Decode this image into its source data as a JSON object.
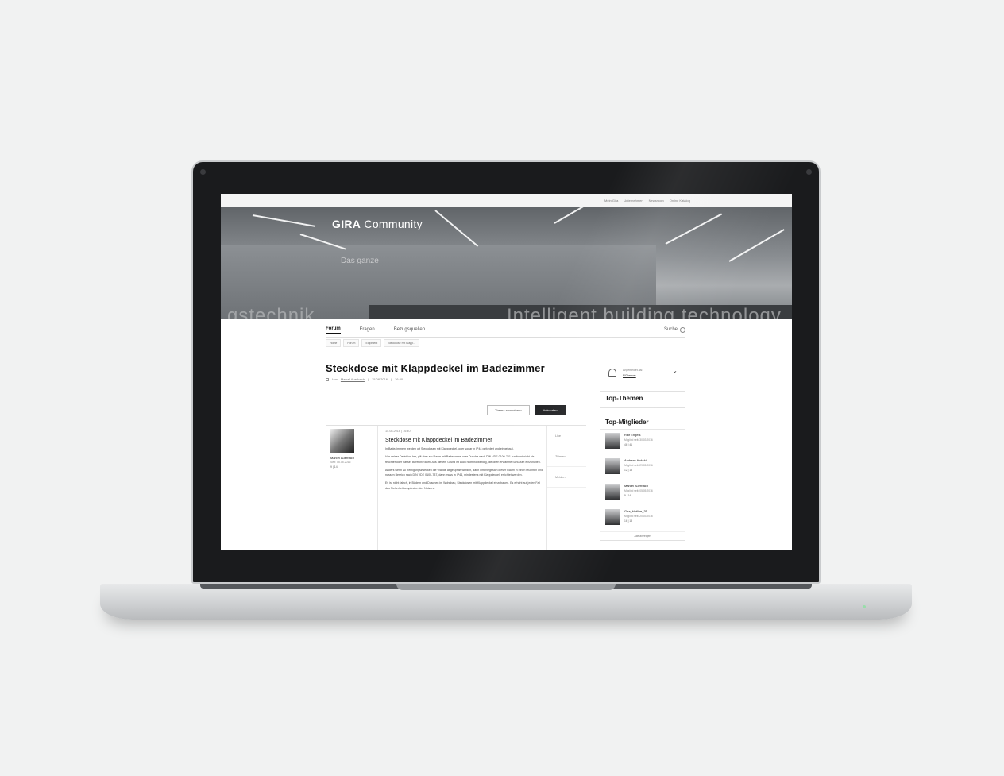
{
  "topbar": {
    "links": [
      "Mein Gira",
      "Unternehmen",
      "Newsroom",
      "Online Katalog"
    ]
  },
  "hero": {
    "logo_bold": "GIRA",
    "logo_light": "Community",
    "claim": "Das ganze",
    "bigtext_left": "gstechnik",
    "bigtext_right": "Intelligent building technology"
  },
  "nav": {
    "items": [
      "Forum",
      "Fragen",
      "Bezugsquellen"
    ],
    "search_label": "Suche"
  },
  "breadcrumbs": [
    "Home",
    "Forum",
    "Elopment",
    "Steckdose mit Klapp..."
  ],
  "thread": {
    "title": "Steckdose mit Klappdeckel im Badezimmer",
    "by": "Von",
    "author": "Marcel Auerbach",
    "date": "15.08.2016",
    "time": "16:40"
  },
  "actions": {
    "subscribe": "Thema abonnieren",
    "reply": "Antworten"
  },
  "post": {
    "author": "Marcel Auerbach",
    "since": "Seit: 05.05.2016",
    "stats": "9  |  14",
    "date": "15.08.2016  |  16:40",
    "title": "Steckdose mit Klappdeckel im Badezimmer",
    "paragraphs": [
      "In Badezimmern werden oft Steckdosen mit Klappdeckel, oder sogar in IP44 gefordert und eingebaut.",
      "Von seiner Definition her, gilt aber ein Raum mit Badewanne oder Dusche nach DIN VDE 0100-701 zunächst nicht als feuchter oder nasser Bereich/Raum. Aus diesem Grund ist auch nicht notwendig, die oben erwähnte Schutzart einzuhalten.",
      "Anders wenn zu Reinigungszwecken die Wände abgespritzt werden, dann unterliegt sich dieser Raum in einen feuchten und nassen Bereich nach DIN VDE 0100-737, dann muss in IP44, mindestens mit Klappdeckel, errichtet werden.",
      "Es ist nicht falsch, in Bädern und Duschen im Wohnbau, Steckdosen mit Klappdeckel einzubauen. Es erhöht auf jeden Fall das Sicherheitsempfinden des Nutzers."
    ]
  },
  "tools": [
    "Like",
    "Zitieren",
    "Melden"
  ],
  "sidebar": {
    "login_hint": "Angemeldet als:",
    "login_user": "RGlasser",
    "top_themes_title": "Top-Themen",
    "top_members_title": "Top-Mitglieder",
    "members": [
      {
        "name": "Ralf Engels",
        "since": "Mitglied seit: 30.03.2016",
        "stats": "46  |  41"
      },
      {
        "name": "Andreas Kokski",
        "since": "Mitglied seit: 29.05.2016",
        "stats": "12  |  18"
      },
      {
        "name": "Marcel Auerbach",
        "since": "Mitglied seit: 05.05.2016",
        "stats": "9  |  14"
      },
      {
        "name": "Gira_Hotline_35",
        "since": "Mitglied seit: 20.03.2016",
        "stats": "16  |  18"
      }
    ],
    "show_all": "Alle anzeigen"
  }
}
